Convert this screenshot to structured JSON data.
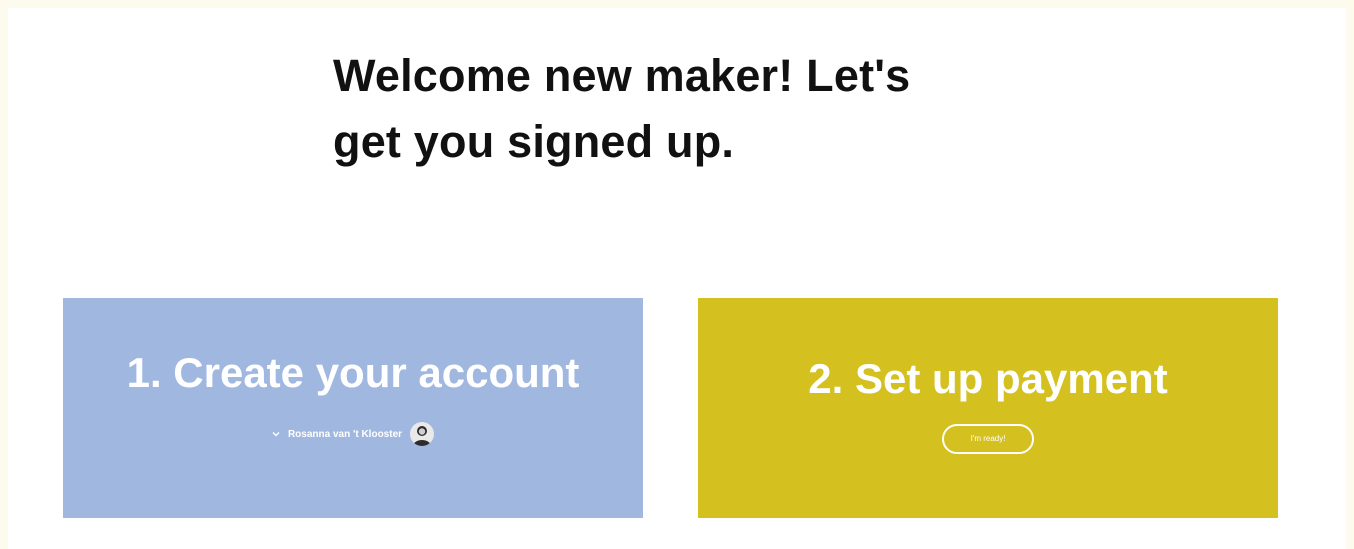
{
  "welcome": {
    "line1": "Welcome new maker! Let's",
    "line2": "get you signed up."
  },
  "steps": [
    {
      "title": "1. Create your account",
      "user_name": "Rosanna van 't Klooster",
      "color": "#a0b8e0"
    },
    {
      "title": "2. Set up payment",
      "button_label": "I'm ready!",
      "color": "#d4c01e"
    }
  ],
  "icons": {
    "dropdown": "chevron-down-icon",
    "avatar": "user-avatar"
  }
}
